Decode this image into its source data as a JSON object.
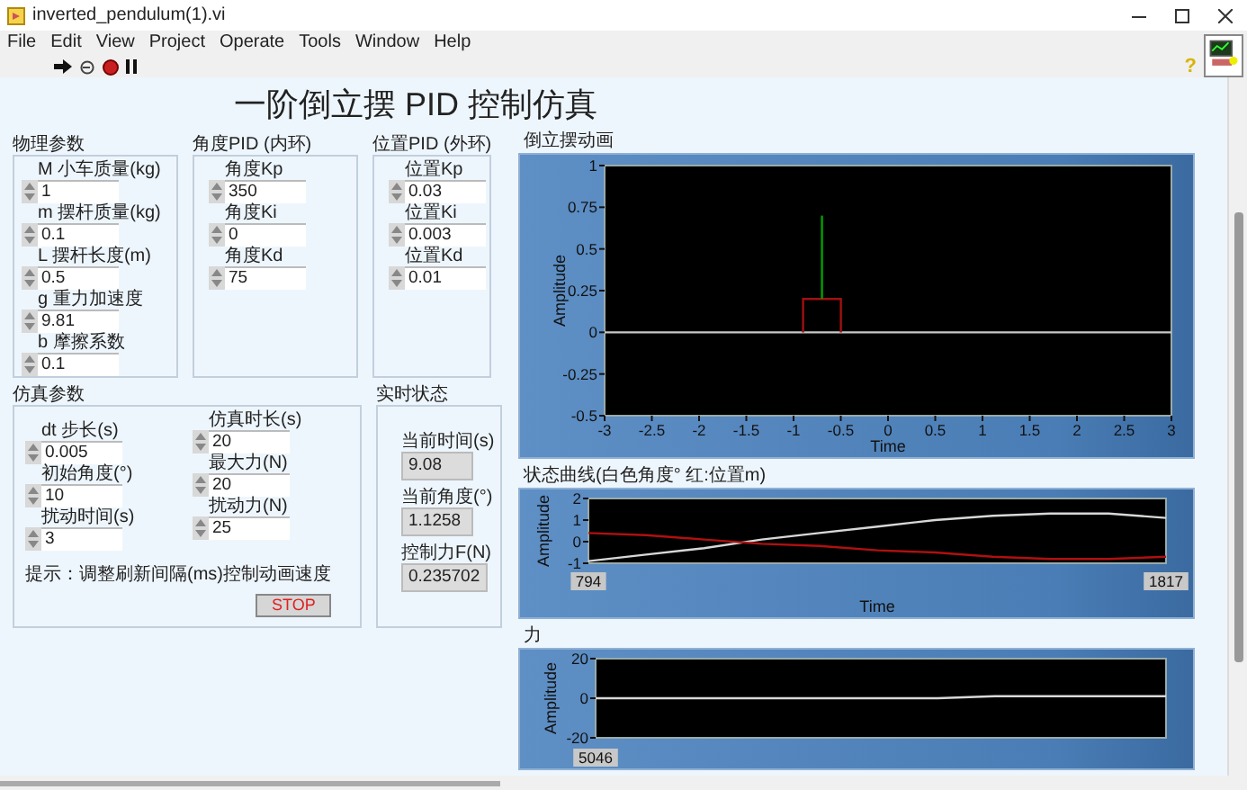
{
  "window": {
    "title": "inverted_pendulum(1).vi"
  },
  "menu": [
    "File",
    "Edit",
    "View",
    "Project",
    "Operate",
    "Tools",
    "Window",
    "Help"
  ],
  "help_glyph": "?",
  "panel_title": "一阶倒立摆 PID 控制仿真",
  "groups": [
    {
      "title": "物理参数",
      "controls": [
        {
          "label": "M 小车质量(kg)",
          "value": "1"
        },
        {
          "label": "m 摆杆质量(kg)",
          "value": "0.1"
        },
        {
          "label": "L 摆杆长度(m)",
          "value": "0.5"
        },
        {
          "label": "g 重力加速度",
          "value": "9.81"
        },
        {
          "label": "b 摩擦系数",
          "value": "0.1"
        }
      ]
    },
    {
      "title": "角度PID (内环)",
      "controls": [
        {
          "label": "角度Kp",
          "value": "350"
        },
        {
          "label": "角度Ki",
          "value": "0"
        },
        {
          "label": "角度Kd",
          "value": "75"
        }
      ]
    },
    {
      "title": "位置PID (外环)",
      "controls": [
        {
          "label": "位置Kp",
          "value": "0.03"
        },
        {
          "label": "位置Ki",
          "value": "0.003"
        },
        {
          "label": "位置Kd",
          "value": "0.01"
        }
      ]
    }
  ],
  "simulation": {
    "title": "仿真参数",
    "columns": [
      [
        {
          "label": "dt 步长(s)",
          "value": "0.005"
        },
        {
          "label": "初始角度(°)",
          "value": "10"
        },
        {
          "label": "扰动时间(s)",
          "value": "3"
        }
      ],
      [
        {
          "label": "仿真时长(s)",
          "value": "20"
        },
        {
          "label": "最大力(N)",
          "value": "20"
        },
        {
          "label": "扰动力(N)",
          "value": "25"
        }
      ]
    ],
    "hint": "提示：调整刷新间隔(ms)控制动画速度",
    "stop_button": "STOP"
  },
  "status": {
    "title": "实时状态",
    "indicators": [
      {
        "label": "当前时间(s)",
        "value": "9.08"
      },
      {
        "label": "当前角度(°)",
        "value": "1.1258"
      },
      {
        "label": "控制力F(N)",
        "value": "0.235702"
      }
    ]
  },
  "charts": [
    {
      "title": "倒立摆动画",
      "chart_data": {
        "type": "line",
        "xlabel": "Time",
        "ylabel": "Amplitude",
        "xlim": [
          -3,
          3
        ],
        "ylim": [
          -0.5,
          1
        ],
        "xticks": [
          -3,
          -2.5,
          -2,
          -1.5,
          -1,
          -0.5,
          0,
          0.5,
          1,
          1.5,
          2,
          2.5,
          3
        ],
        "yticks": [
          -0.5,
          -0.25,
          0,
          0.25,
          0.5,
          0.75,
          1
        ],
        "series": [
          {
            "color": "#c8c8c8",
            "x": [
              -3,
              3
            ],
            "values": [
              0,
              0
            ]
          },
          {
            "color": "#a01010",
            "x": [
              -0.9,
              -0.9,
              -0.5,
              -0.5
            ],
            "values": [
              0,
              0.2,
              0.2,
              0
            ]
          },
          {
            "color": "#00a000",
            "x": [
              -0.7,
              -0.7
            ],
            "values": [
              0.2,
              0.7
            ]
          }
        ]
      }
    },
    {
      "title": "状态曲线(白色角度° 红:位置m)",
      "chart_data": {
        "type": "line",
        "xlabel": "Time",
        "ylabel": "Amplitude",
        "x": [
          794,
          896,
          999,
          1101,
          1203,
          1306,
          1408,
          1510,
          1612,
          1715,
          1817
        ],
        "xlim": [
          794,
          1817
        ],
        "ylim": [
          -1,
          2
        ],
        "xticks": [
          {
            "value": 794,
            "label": "794"
          },
          {
            "value": 1817,
            "label": "1817"
          }
        ],
        "yticks": [
          -1,
          0,
          1,
          2
        ],
        "series": [
          {
            "color": "#d8d8d8",
            "values": [
              -0.9,
              -0.6,
              -0.3,
              0.1,
              0.4,
              0.7,
              1,
              1.2,
              1.3,
              1.3,
              1.1
            ]
          },
          {
            "color": "#b01010",
            "values": [
              0.4,
              0.3,
              0.1,
              -0.1,
              -0.2,
              -0.4,
              -0.5,
              -0.7,
              -0.8,
              -0.8,
              -0.7
            ]
          }
        ]
      }
    },
    {
      "title": "力",
      "chart_data": {
        "type": "line",
        "ylabel": "Amplitude",
        "ylim": [
          -20,
          20
        ],
        "yticks": [
          -20,
          0,
          20
        ],
        "annotations": [
          {
            "text": "5046"
          }
        ],
        "series": [
          {
            "color": "#d8d8d8",
            "values": [
              0,
              0,
              0,
              0,
              0,
              0,
              0,
              1,
              1,
              1,
              1
            ]
          }
        ]
      }
    }
  ]
}
